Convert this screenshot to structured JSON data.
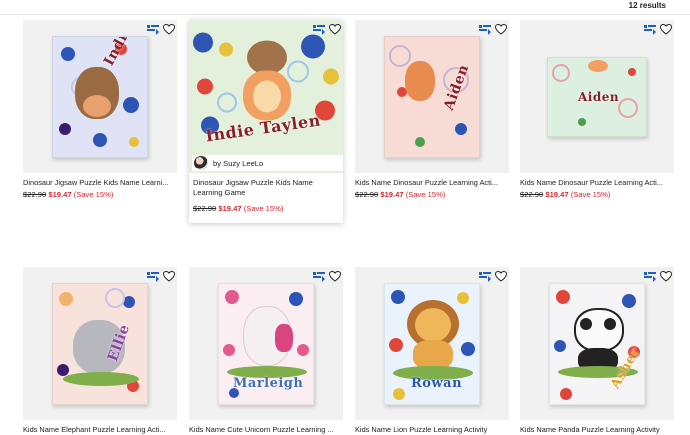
{
  "results": {
    "count_label": "12 results"
  },
  "colors": {
    "sale": "#d8262f",
    "accent_flip": "#1f5fc4"
  },
  "icons": {
    "flip": "flip-card-icon",
    "favorite": "heart-icon"
  },
  "products": [
    {
      "title": "Dinosaur Jigsaw Puzzle Kids Name Learni...",
      "old_price": "$22.90",
      "new_price": "$19.47",
      "save": "(Save 15%)",
      "name_text": "Indie Tayler",
      "animal": "dinosaur"
    },
    {
      "title": "Dinosaur Jigsaw Puzzle Kids Name Learning Game",
      "old_price": "$22.90",
      "new_price": "$19.47",
      "save": "(Save 15%)",
      "name_text": "Indie Taylen",
      "animal": "dinosaur",
      "seller": "by Suzy LeeLo"
    },
    {
      "title": "Kids Name Dinosaur Puzzle Learning Acti...",
      "old_price": "$22.90",
      "new_price": "$19.47",
      "save": "(Save 15%)",
      "name_text": "Aiden",
      "animal": "dinosaur"
    },
    {
      "title": "Kids Name Dinosaur Puzzle Learning Acti...",
      "old_price": "$22.90",
      "new_price": "$19.47",
      "save": "(Save 15%)",
      "name_text": "Aiden",
      "animal": "dinosaur"
    },
    {
      "title": "Kids Name Elephant Puzzle Learning Acti...",
      "name_text": "Ellie",
      "animal": "elephant"
    },
    {
      "title": "Kids Name Cute Unicorn Puzzle Learning ...",
      "name_text": "Marleigh",
      "animal": "unicorn"
    },
    {
      "title": "Kids Name Lion Puzzle Learning Activity",
      "name_text": "Rowan",
      "animal": "lion"
    },
    {
      "title": "Kids Name Panda Puzzle Learning Activity",
      "name_text": "Asher",
      "animal": "panda"
    }
  ]
}
